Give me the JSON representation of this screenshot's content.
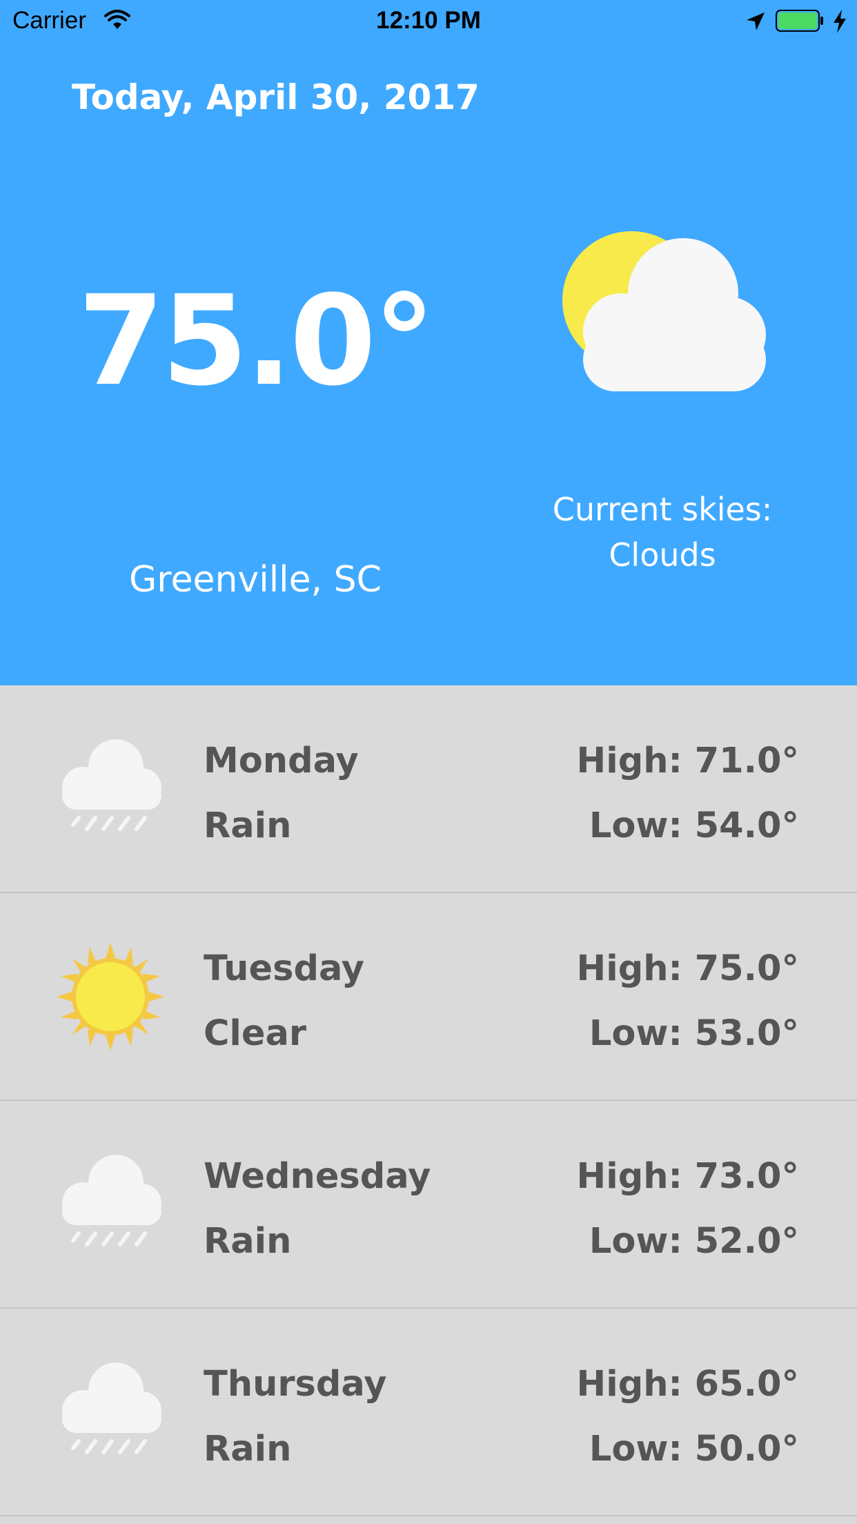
{
  "status_bar": {
    "carrier": "Carrier",
    "time": "12:10 PM"
  },
  "current": {
    "date": "Today, April 30, 2017",
    "temperature": "75.0°",
    "city": "Greenville, SC",
    "skies_label": "Current skies:",
    "skies_value": "Clouds",
    "icon": "partly-cloudy-icon"
  },
  "forecast": [
    {
      "day": "Monday",
      "condition": "Rain",
      "high": "High: 71.0°",
      "low": "Low: 54.0°",
      "icon": "rain-cloud-icon"
    },
    {
      "day": "Tuesday",
      "condition": "Clear",
      "high": "High: 75.0°",
      "low": "Low: 53.0°",
      "icon": "sun-icon"
    },
    {
      "day": "Wednesday",
      "condition": "Rain",
      "high": "High: 73.0°",
      "low": "Low: 52.0°",
      "icon": "rain-cloud-icon"
    },
    {
      "day": "Thursday",
      "condition": "Rain",
      "high": "High: 65.0°",
      "low": "Low: 50.0°",
      "icon": "rain-cloud-icon"
    }
  ],
  "colors": {
    "hero_background": "#3fa9ff",
    "list_background": "#dadada",
    "list_text": "#555555",
    "sun_yellow": "#f7ea4a",
    "battery_green": "#4cd964"
  }
}
